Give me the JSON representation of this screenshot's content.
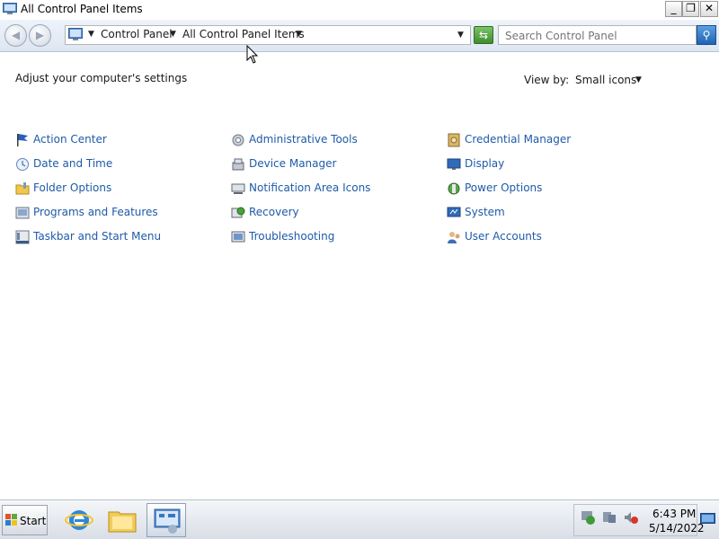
{
  "window": {
    "title": "All Control Panel Items",
    "controls": {
      "minimize": "_",
      "maximize": "❐",
      "close": "✕"
    }
  },
  "address_bar": {
    "breadcrumbs": [
      "Control Panel",
      "All Control Panel Items"
    ],
    "search_placeholder": "Search Control Panel"
  },
  "content": {
    "heading": "Adjust your computer's settings",
    "view_by_label": "View by:",
    "view_by_value": "Small icons",
    "columns": [
      [
        {
          "label": "Action Center",
          "icon": "action-center-flag-icon"
        },
        {
          "label": "Date and Time",
          "icon": "clock-icon"
        },
        {
          "label": "Folder Options",
          "icon": "folder-options-icon"
        },
        {
          "label": "Programs and Features",
          "icon": "programs-icon"
        },
        {
          "label": "Taskbar and Start Menu",
          "icon": "taskbar-icon"
        }
      ],
      [
        {
          "label": "Administrative Tools",
          "icon": "admin-tools-icon"
        },
        {
          "label": "Device Manager",
          "icon": "device-manager-icon"
        },
        {
          "label": "Notification Area Icons",
          "icon": "notification-area-icon"
        },
        {
          "label": "Recovery",
          "icon": "recovery-icon"
        },
        {
          "label": "Troubleshooting",
          "icon": "troubleshooting-icon"
        }
      ],
      [
        {
          "label": "Credential Manager",
          "icon": "credential-manager-icon"
        },
        {
          "label": "Display",
          "icon": "display-icon"
        },
        {
          "label": "Power Options",
          "icon": "power-options-icon"
        },
        {
          "label": "System",
          "icon": "system-icon"
        },
        {
          "label": "User Accounts",
          "icon": "user-accounts-icon"
        }
      ]
    ]
  },
  "taskbar": {
    "start_label": "Start",
    "apps": [
      "internet-explorer-icon",
      "windows-explorer-icon",
      "control-panel-icon"
    ],
    "clock": {
      "time": "6:43 PM",
      "date": "5/14/2022"
    }
  },
  "colors": {
    "link": "#1f5aa8",
    "taskbar_top": "#f4f6f9",
    "navbar": "#dde6f2"
  }
}
